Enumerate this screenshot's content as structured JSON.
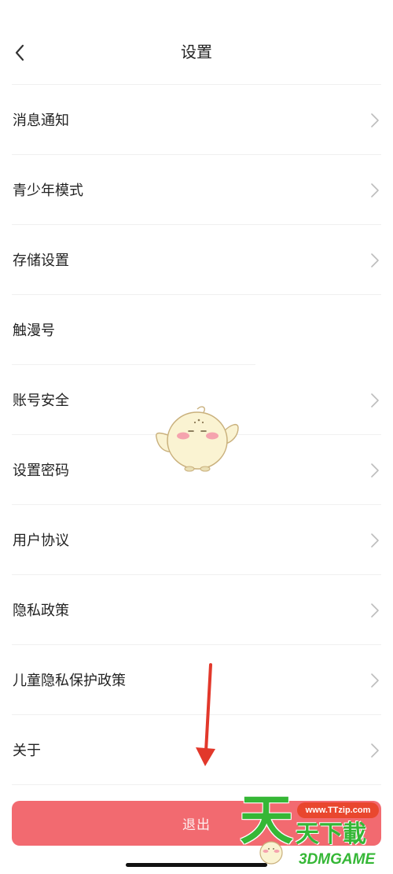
{
  "header": {
    "title": "设置",
    "back_icon": "chevron-left-icon"
  },
  "settings": {
    "chevron_icon": "chevron-right-icon",
    "items": [
      {
        "label": "消息通知",
        "chevron": true
      },
      {
        "label": "青少年模式",
        "chevron": true
      },
      {
        "label": "存储设置",
        "chevron": true
      },
      {
        "label": "触漫号",
        "chevron": false
      },
      {
        "label": "账号安全",
        "chevron": true
      },
      {
        "label": "设置密码",
        "chevron": true
      },
      {
        "label": "用户协议",
        "chevron": true
      },
      {
        "label": "隐私政策",
        "chevron": true
      },
      {
        "label": "儿童隐私保护政策",
        "chevron": true
      },
      {
        "label": "关于",
        "chevron": true
      }
    ]
  },
  "logout": {
    "label": "退出"
  },
  "annotation": {
    "type": "arrow",
    "color": "#E2382B"
  },
  "watermark": {
    "brand_big": "天",
    "site": "www.TTzip.com",
    "brand_rest": "天下載",
    "game": "3DMGAME",
    "color": "#35B736"
  },
  "colors": {
    "text": "#222222",
    "chevron": "#BDBDBD",
    "divider": "#F0F0F0",
    "logout_button": "#F26A70",
    "logout_text": "#FFFFFF"
  }
}
